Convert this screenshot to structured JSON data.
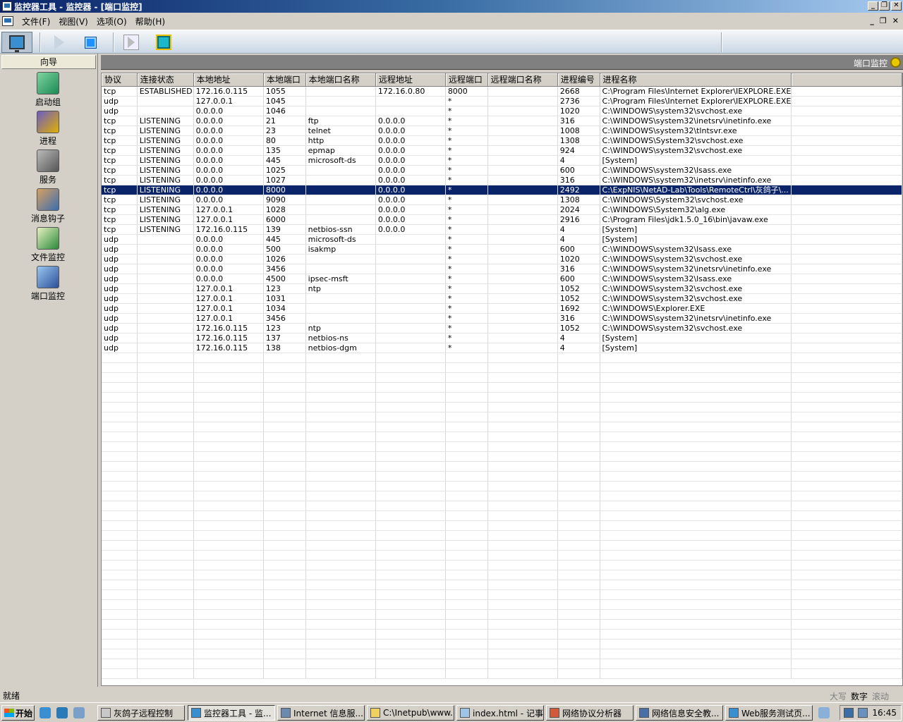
{
  "window": {
    "title": "监控器工具 - 监控器 - [端口监控]"
  },
  "menu": [
    "文件(F)",
    "视图(V)",
    "选项(O)",
    "帮助(H)"
  ],
  "toolbar": {
    "icons": [
      "monitor-icon",
      "play-icon",
      "stop-icon",
      "step-icon",
      "refresh-icon"
    ]
  },
  "wizard": {
    "title": "向导",
    "items": [
      {
        "label": "启动组",
        "icon": "startup-group-icon"
      },
      {
        "label": "进程",
        "icon": "process-icon"
      },
      {
        "label": "服务",
        "icon": "service-icon"
      },
      {
        "label": "消息钩子",
        "icon": "message-hook-icon"
      },
      {
        "label": "文件监控",
        "icon": "file-monitor-icon"
      },
      {
        "label": "端口监控",
        "icon": "port-monitor-icon"
      }
    ]
  },
  "panel": {
    "title": "端口监控"
  },
  "table": {
    "columns": [
      "协议",
      "连接状态",
      "本地地址",
      "本地端口",
      "本地端口名称",
      "远程地址",
      "远程端口",
      "远程端口名称",
      "进程编号",
      "进程名称"
    ],
    "selected_index": 10,
    "rows": [
      [
        "tcp",
        "ESTABLISHED",
        "172.16.0.115",
        "1055",
        "",
        "172.16.0.80",
        "8000",
        "",
        "2668",
        "C:\\Program Files\\Internet Explorer\\IEXPLORE.EXE"
      ],
      [
        "udp",
        "",
        "127.0.0.1",
        "1045",
        "",
        "",
        "*",
        "",
        "2736",
        "C:\\Program Files\\Internet Explorer\\IEXPLORE.EXE"
      ],
      [
        "udp",
        "",
        "0.0.0.0",
        "1046",
        "",
        "",
        "*",
        "",
        "1020",
        "C:\\WINDOWS\\system32\\svchost.exe"
      ],
      [
        "tcp",
        "LISTENING",
        "0.0.0.0",
        "21",
        "ftp",
        "0.0.0.0",
        "*",
        "",
        "316",
        "C:\\WINDOWS\\system32\\inetsrv\\inetinfo.exe"
      ],
      [
        "tcp",
        "LISTENING",
        "0.0.0.0",
        "23",
        "telnet",
        "0.0.0.0",
        "*",
        "",
        "1008",
        "C:\\WINDOWS\\system32\\tlntsvr.exe"
      ],
      [
        "tcp",
        "LISTENING",
        "0.0.0.0",
        "80",
        "http",
        "0.0.0.0",
        "*",
        "",
        "1308",
        "C:\\WINDOWS\\System32\\svchost.exe"
      ],
      [
        "tcp",
        "LISTENING",
        "0.0.0.0",
        "135",
        "epmap",
        "0.0.0.0",
        "*",
        "",
        "924",
        "C:\\WINDOWS\\system32\\svchost.exe"
      ],
      [
        "tcp",
        "LISTENING",
        "0.0.0.0",
        "445",
        "microsoft-ds",
        "0.0.0.0",
        "*",
        "",
        "4",
        "[System]"
      ],
      [
        "tcp",
        "LISTENING",
        "0.0.0.0",
        "1025",
        "",
        "0.0.0.0",
        "*",
        "",
        "600",
        "C:\\WINDOWS\\system32\\lsass.exe"
      ],
      [
        "tcp",
        "LISTENING",
        "0.0.0.0",
        "1027",
        "",
        "0.0.0.0",
        "*",
        "",
        "316",
        "C:\\WINDOWS\\system32\\inetsrv\\inetinfo.exe"
      ],
      [
        "tcp",
        "LISTENING",
        "0.0.0.0",
        "8000",
        "",
        "0.0.0.0",
        "*",
        "",
        "2492",
        "C:\\ExpNIS\\NetAD-Lab\\Tools\\RemoteCtrl\\灰鸽子\\..."
      ],
      [
        "tcp",
        "LISTENING",
        "0.0.0.0",
        "9090",
        "",
        "0.0.0.0",
        "*",
        "",
        "1308",
        "C:\\WINDOWS\\System32\\svchost.exe"
      ],
      [
        "tcp",
        "LISTENING",
        "127.0.0.1",
        "1028",
        "",
        "0.0.0.0",
        "*",
        "",
        "2024",
        "C:\\WINDOWS\\System32\\alg.exe"
      ],
      [
        "tcp",
        "LISTENING",
        "127.0.0.1",
        "6000",
        "",
        "0.0.0.0",
        "*",
        "",
        "2916",
        "C:\\Program Files\\jdk1.5.0_16\\bin\\javaw.exe"
      ],
      [
        "tcp",
        "LISTENING",
        "172.16.0.115",
        "139",
        "netbios-ssn",
        "0.0.0.0",
        "*",
        "",
        "4",
        "[System]"
      ],
      [
        "udp",
        "",
        "0.0.0.0",
        "445",
        "microsoft-ds",
        "",
        "*",
        "",
        "4",
        "[System]"
      ],
      [
        "udp",
        "",
        "0.0.0.0",
        "500",
        "isakmp",
        "",
        "*",
        "",
        "600",
        "C:\\WINDOWS\\system32\\lsass.exe"
      ],
      [
        "udp",
        "",
        "0.0.0.0",
        "1026",
        "",
        "",
        "*",
        "",
        "1020",
        "C:\\WINDOWS\\system32\\svchost.exe"
      ],
      [
        "udp",
        "",
        "0.0.0.0",
        "3456",
        "",
        "",
        "*",
        "",
        "316",
        "C:\\WINDOWS\\system32\\inetsrv\\inetinfo.exe"
      ],
      [
        "udp",
        "",
        "0.0.0.0",
        "4500",
        "ipsec-msft",
        "",
        "*",
        "",
        "600",
        "C:\\WINDOWS\\system32\\lsass.exe"
      ],
      [
        "udp",
        "",
        "127.0.0.1",
        "123",
        "ntp",
        "",
        "*",
        "",
        "1052",
        "C:\\WINDOWS\\system32\\svchost.exe"
      ],
      [
        "udp",
        "",
        "127.0.0.1",
        "1031",
        "",
        "",
        "*",
        "",
        "1052",
        "C:\\WINDOWS\\system32\\svchost.exe"
      ],
      [
        "udp",
        "",
        "127.0.0.1",
        "1034",
        "",
        "",
        "*",
        "",
        "1692",
        "C:\\WINDOWS\\Explorer.EXE"
      ],
      [
        "udp",
        "",
        "127.0.0.1",
        "3456",
        "",
        "",
        "*",
        "",
        "316",
        "C:\\WINDOWS\\system32\\inetsrv\\inetinfo.exe"
      ],
      [
        "udp",
        "",
        "172.16.0.115",
        "123",
        "ntp",
        "",
        "*",
        "",
        "1052",
        "C:\\WINDOWS\\system32\\svchost.exe"
      ],
      [
        "udp",
        "",
        "172.16.0.115",
        "137",
        "netbios-ns",
        "",
        "*",
        "",
        "4",
        "[System]"
      ],
      [
        "udp",
        "",
        "172.16.0.115",
        "138",
        "netbios-dgm",
        "",
        "*",
        "",
        "4",
        "[System]"
      ]
    ]
  },
  "status": {
    "text": "就绪",
    "indicators": [
      {
        "label": "大写",
        "active": false
      },
      {
        "label": "数字",
        "active": true
      },
      {
        "label": "滚动",
        "active": false
      }
    ]
  },
  "taskbar": {
    "start": "开始",
    "tasks": [
      {
        "label": "灰鸽子远程控制",
        "active": false
      },
      {
        "label": "监控器工具 - 监...",
        "active": true
      },
      {
        "label": "Internet 信息服...",
        "active": false
      },
      {
        "label": "C:\\Inetpub\\www...",
        "active": false
      },
      {
        "label": "index.html - 记事本",
        "active": false
      },
      {
        "label": "网络协议分析器",
        "active": false
      },
      {
        "label": "网络信息安全教...",
        "active": false
      },
      {
        "label": "Web服务测试页...",
        "active": false
      }
    ],
    "clock": "16:45"
  }
}
